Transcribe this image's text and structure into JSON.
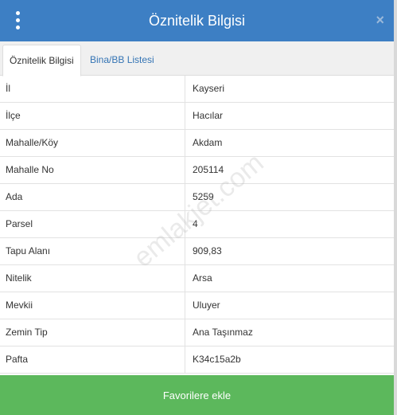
{
  "header": {
    "title": "Öznitelik Bilgisi",
    "close_glyph": "×"
  },
  "tabs": [
    {
      "label": "Öznitelik Bilgisi",
      "active": true
    },
    {
      "label": "Bina/BB Listesi",
      "active": false
    }
  ],
  "attributes": [
    {
      "key": "İl",
      "value": "Kayseri"
    },
    {
      "key": "İlçe",
      "value": "Hacılar"
    },
    {
      "key": "Mahalle/Köy",
      "value": "Akdam"
    },
    {
      "key": "Mahalle No",
      "value": "205114"
    },
    {
      "key": "Ada",
      "value": "5259"
    },
    {
      "key": "Parsel",
      "value": "4"
    },
    {
      "key": "Tapu Alanı",
      "value": "909,83"
    },
    {
      "key": "Nitelik",
      "value": "Arsa"
    },
    {
      "key": "Mevkii",
      "value": "Uluyer"
    },
    {
      "key": "Zemin Tip",
      "value": "Ana Taşınmaz"
    },
    {
      "key": "Pafta",
      "value": "K34c15a2b"
    }
  ],
  "watermark": "emlakjet.com",
  "footer": {
    "favorite_button_label": "Favorilere ekle"
  },
  "colors": {
    "header_bg": "#3d7fc4",
    "tab_link": "#3474b4",
    "button_green": "#5cb85c"
  },
  "icons": {
    "menu": "kebab-menu-icon",
    "close": "close-icon"
  }
}
